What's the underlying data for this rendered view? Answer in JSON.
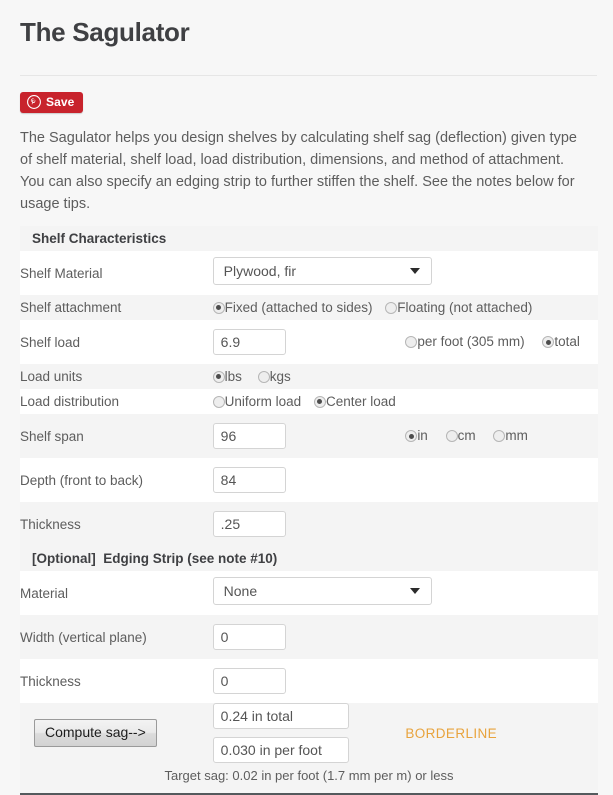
{
  "page": {
    "title": "The Sagulator",
    "intro": "The Sagulator helps you design shelves by calculating shelf sag (deflection) given type of shelf material, shelf load, load distribution, dimensions, and method of attachment. You can also specify an edging strip to further stiffen the shelf. See the notes below for usage tips.",
    "accent_verdict_color": "#e8a33d",
    "pin_button_color": "#c8232c"
  },
  "save_button": {
    "label": "Save",
    "icon": "pinterest-icon"
  },
  "shelf_section": {
    "heading": "Shelf Characteristics",
    "material": {
      "label": "Shelf Material",
      "value": "Plywood, fir"
    },
    "attachment": {
      "label": "Shelf attachment",
      "options": [
        {
          "label": "Fixed (attached to sides)",
          "selected": true
        },
        {
          "label": "Floating (not attached)",
          "selected": false
        }
      ]
    },
    "load": {
      "label": "Shelf load",
      "value": "6.9",
      "basis_options": [
        {
          "label": "per foot (305 mm)",
          "selected": false
        },
        {
          "label": "total",
          "selected": true
        }
      ]
    },
    "load_units": {
      "label": "Load units",
      "options": [
        {
          "label": "lbs",
          "selected": true
        },
        {
          "label": "kgs",
          "selected": false
        }
      ]
    },
    "load_distribution": {
      "label": "Load distribution",
      "options": [
        {
          "label": "Uniform load",
          "selected": false
        },
        {
          "label": "Center load",
          "selected": true
        }
      ]
    },
    "span": {
      "label": "Shelf span",
      "value": "96",
      "unit_options": [
        {
          "label": "in",
          "selected": true
        },
        {
          "label": "cm",
          "selected": false
        },
        {
          "label": "mm",
          "selected": false
        }
      ]
    },
    "depth": {
      "label": "Depth (front to back)",
      "value": "84"
    },
    "thickness": {
      "label": "Thickness",
      "value": ".25"
    }
  },
  "edging_section": {
    "heading_bracket": "[Optional]",
    "heading_rest": "Edging Strip (see note #10)",
    "material": {
      "label": "Material",
      "value": "None"
    },
    "width": {
      "label": "Width (vertical plane)",
      "value": "0"
    },
    "thickness": {
      "label": "Thickness",
      "value": "0"
    }
  },
  "results": {
    "compute_button": "Compute sag-->",
    "sag_total": "0.24 in total",
    "sag_per_foot": "0.030 in per foot",
    "verdict": "BORDERLINE",
    "target_note": "Target sag: 0.02 in per foot (1.7 mm per m) or less"
  }
}
